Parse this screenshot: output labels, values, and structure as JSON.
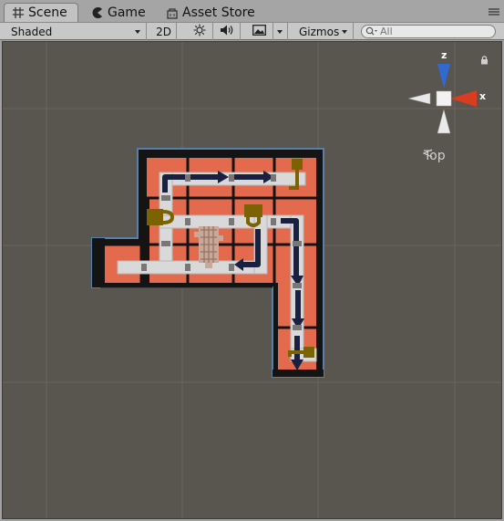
{
  "window": {
    "tabs": [
      {
        "label": "Scene",
        "icon": "grid-icon",
        "active": true
      },
      {
        "label": "Game",
        "icon": "pacman-icon",
        "active": false
      },
      {
        "label": "Asset Store",
        "icon": "store-icon",
        "active": false
      }
    ],
    "menu_icon": "menu-icon"
  },
  "toolbar": {
    "shading_mode": "Shaded",
    "mode_2d": "2D",
    "lighting_icon": "sun-icon",
    "audio_icon": "speaker-icon",
    "effects_icon": "image-icon",
    "gizmos_label": "Gizmos",
    "search_placeholder": "All"
  },
  "scene": {
    "background_color": "#59554f",
    "gizmo": {
      "z_label": "z",
      "x_label": "x",
      "view_label": "Top"
    },
    "colors": {
      "floor": "#e36a4c",
      "path": "#d9d9d9",
      "arrow": "#1a2140",
      "key": "#7a6300",
      "wall": "#141414",
      "selection_outline": "#5a7fa8"
    }
  }
}
